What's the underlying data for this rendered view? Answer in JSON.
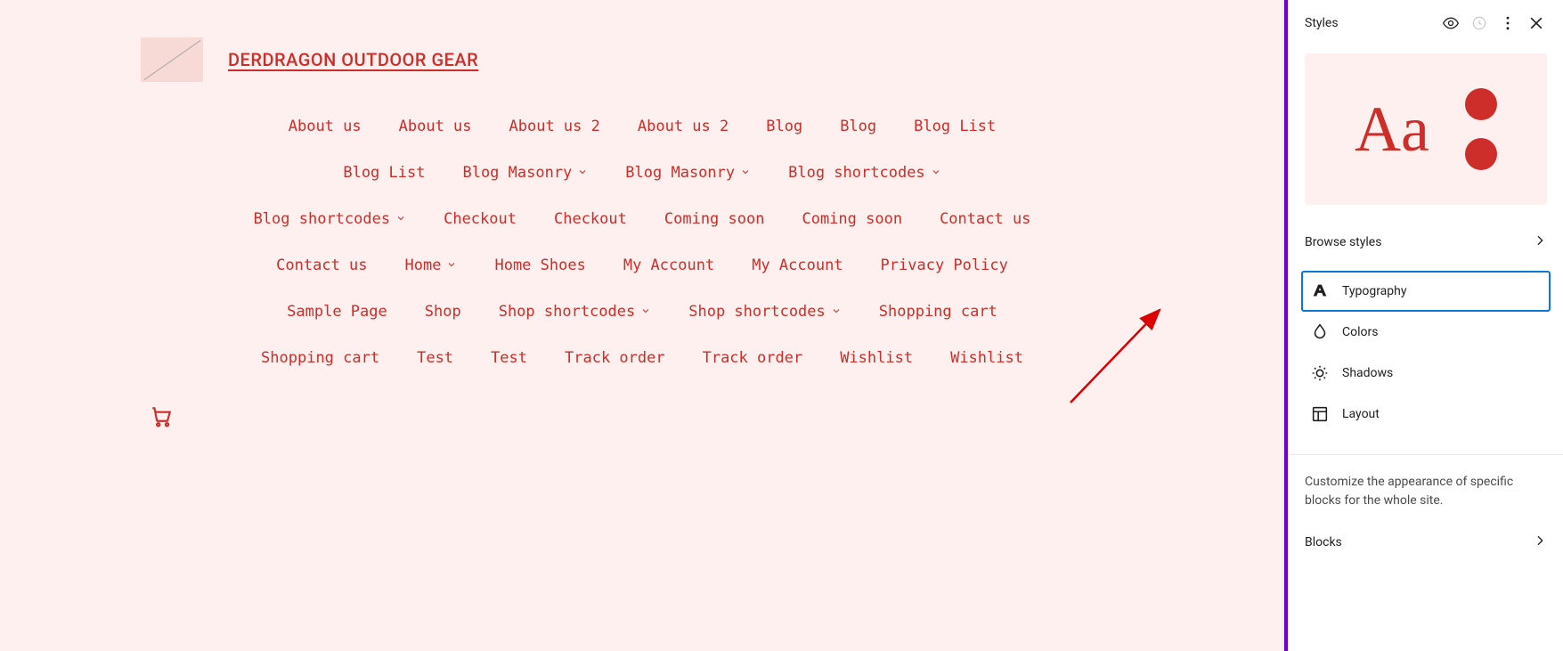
{
  "site": {
    "title": "DERDRAGON OUTDOOR GEAR"
  },
  "nav": [
    {
      "label": "About us",
      "dropdown": false
    },
    {
      "label": "About us",
      "dropdown": false
    },
    {
      "label": "About us 2",
      "dropdown": false
    },
    {
      "label": "About us 2",
      "dropdown": false
    },
    {
      "label": "Blog",
      "dropdown": false
    },
    {
      "label": "Blog",
      "dropdown": false
    },
    {
      "label": "Blog List",
      "dropdown": false
    },
    {
      "label": "Blog List",
      "dropdown": false
    },
    {
      "label": "Blog Masonry",
      "dropdown": true
    },
    {
      "label": "Blog Masonry",
      "dropdown": true
    },
    {
      "label": "Blog shortcodes",
      "dropdown": true
    },
    {
      "label": "Blog shortcodes",
      "dropdown": true
    },
    {
      "label": "Checkout",
      "dropdown": false
    },
    {
      "label": "Checkout",
      "dropdown": false
    },
    {
      "label": "Coming soon",
      "dropdown": false
    },
    {
      "label": "Coming soon",
      "dropdown": false
    },
    {
      "label": "Contact us",
      "dropdown": false
    },
    {
      "label": "Contact us",
      "dropdown": false
    },
    {
      "label": "Home",
      "dropdown": true
    },
    {
      "label": "Home Shoes",
      "dropdown": false
    },
    {
      "label": "My Account",
      "dropdown": false
    },
    {
      "label": "My Account",
      "dropdown": false
    },
    {
      "label": "Privacy Policy",
      "dropdown": false
    },
    {
      "label": "Sample Page",
      "dropdown": false
    },
    {
      "label": "Shop",
      "dropdown": false
    },
    {
      "label": "Shop shortcodes",
      "dropdown": true
    },
    {
      "label": "Shop shortcodes",
      "dropdown": true
    },
    {
      "label": "Shopping cart",
      "dropdown": false
    },
    {
      "label": "Shopping cart",
      "dropdown": false
    },
    {
      "label": "Test",
      "dropdown": false
    },
    {
      "label": "Test",
      "dropdown": false
    },
    {
      "label": "Track order",
      "dropdown": false
    },
    {
      "label": "Track order",
      "dropdown": false
    },
    {
      "label": "Wishlist",
      "dropdown": false
    },
    {
      "label": "Wishlist",
      "dropdown": false
    }
  ],
  "sidebar": {
    "title": "Styles",
    "preview_text": "Aa",
    "browse_label": "Browse styles",
    "items": [
      {
        "label": "Typography",
        "icon": "typography",
        "active": true
      },
      {
        "label": "Colors",
        "icon": "colors",
        "active": false
      },
      {
        "label": "Shadows",
        "icon": "shadows",
        "active": false
      },
      {
        "label": "Layout",
        "icon": "layout",
        "active": false
      }
    ],
    "blocks_description": "Customize the appearance of specific blocks for the whole site.",
    "blocks_label": "Blocks"
  },
  "colors": {
    "accent": "#cd2e29",
    "canvas_bg": "#fdf0ee",
    "selection_border": "#7200cc",
    "highlight": "#0a78d6"
  }
}
